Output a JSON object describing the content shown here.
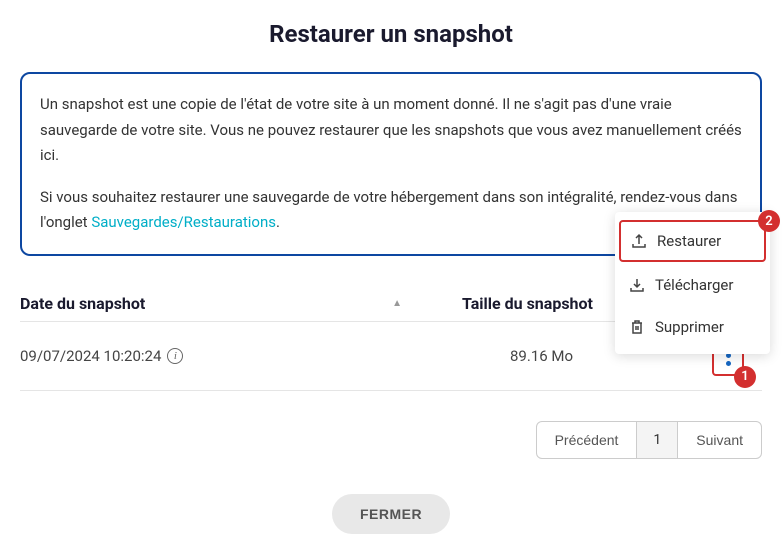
{
  "title": "Restaurer un snapshot",
  "info": {
    "paragraph1": "Un snapshot est une copie de l'état de votre site à un moment donné. Il ne s'agit pas d'une vraie sauvegarde de votre site. Vous ne pouvez restaurer que les snapshots que vous avez manuellement créés ici.",
    "paragraph2_prefix": "Si vous souhaitez restaurer une sauvegarde de votre hébergement dans son intégralité, rendez-vous dans l'onglet ",
    "link_text": "Sauvegardes/Restaurations",
    "paragraph2_suffix": "."
  },
  "table": {
    "headers": {
      "date": "Date du snapshot",
      "size": "Taille du snapshot"
    },
    "rows": [
      {
        "date": "09/07/2024 10:20:24",
        "size": "89.16 Mo"
      }
    ]
  },
  "dropdown": {
    "restore": "Restaurer",
    "download": "Télécharger",
    "delete": "Supprimer"
  },
  "annotations": {
    "badge1": "1",
    "badge2": "2"
  },
  "pagination": {
    "prev": "Précédent",
    "page": "1",
    "next": "Suivant"
  },
  "close_label": "FERMER"
}
